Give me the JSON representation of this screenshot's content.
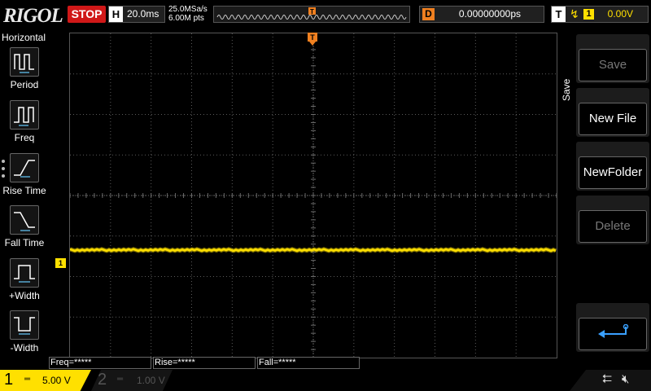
{
  "top": {
    "logo": "RIGOL",
    "run_state": "STOP",
    "horizontal_key": "H",
    "timebase": "20.0ms",
    "sample_rate": "25.0MSa/s",
    "memory_depth": "6.00M pts",
    "delay_key": "D",
    "delay": "0.00000000ps",
    "trigger_key": "T",
    "trigger_source": "1",
    "trigger_level": "0.00V"
  },
  "left_menu": {
    "title": "Horizontal",
    "items": [
      {
        "label": "Period",
        "icon": "period-icon"
      },
      {
        "label": "Freq",
        "icon": "frequency-icon"
      },
      {
        "label": "Rise Time",
        "icon": "rise-time-icon"
      },
      {
        "label": "Fall Time",
        "icon": "fall-time-icon"
      },
      {
        "label": "+Width",
        "icon": "positive-width-icon"
      },
      {
        "label": "-Width",
        "icon": "negative-width-icon"
      }
    ]
  },
  "channel1_marker": "1",
  "trigger_marker": "T",
  "measurements": [
    {
      "label": "Freq=*****"
    },
    {
      "label": "Rise=*****"
    },
    {
      "label": "Fall=*****"
    }
  ],
  "right_menu": {
    "title": "Save",
    "buttons": [
      {
        "label": "Save",
        "enabled": false
      },
      {
        "label": "New File",
        "enabled": true
      },
      {
        "label": "NewFolder",
        "enabled": true
      },
      {
        "label": "Delete",
        "enabled": false
      }
    ]
  },
  "bottom": {
    "ch1_number": "1",
    "ch1_scale": "5.00 V",
    "ch2_number": "2",
    "ch2_scale": "1.00 V"
  },
  "colors": {
    "ch1": "#ffe000",
    "trigger": "#f08020",
    "stop": "#d01818"
  }
}
